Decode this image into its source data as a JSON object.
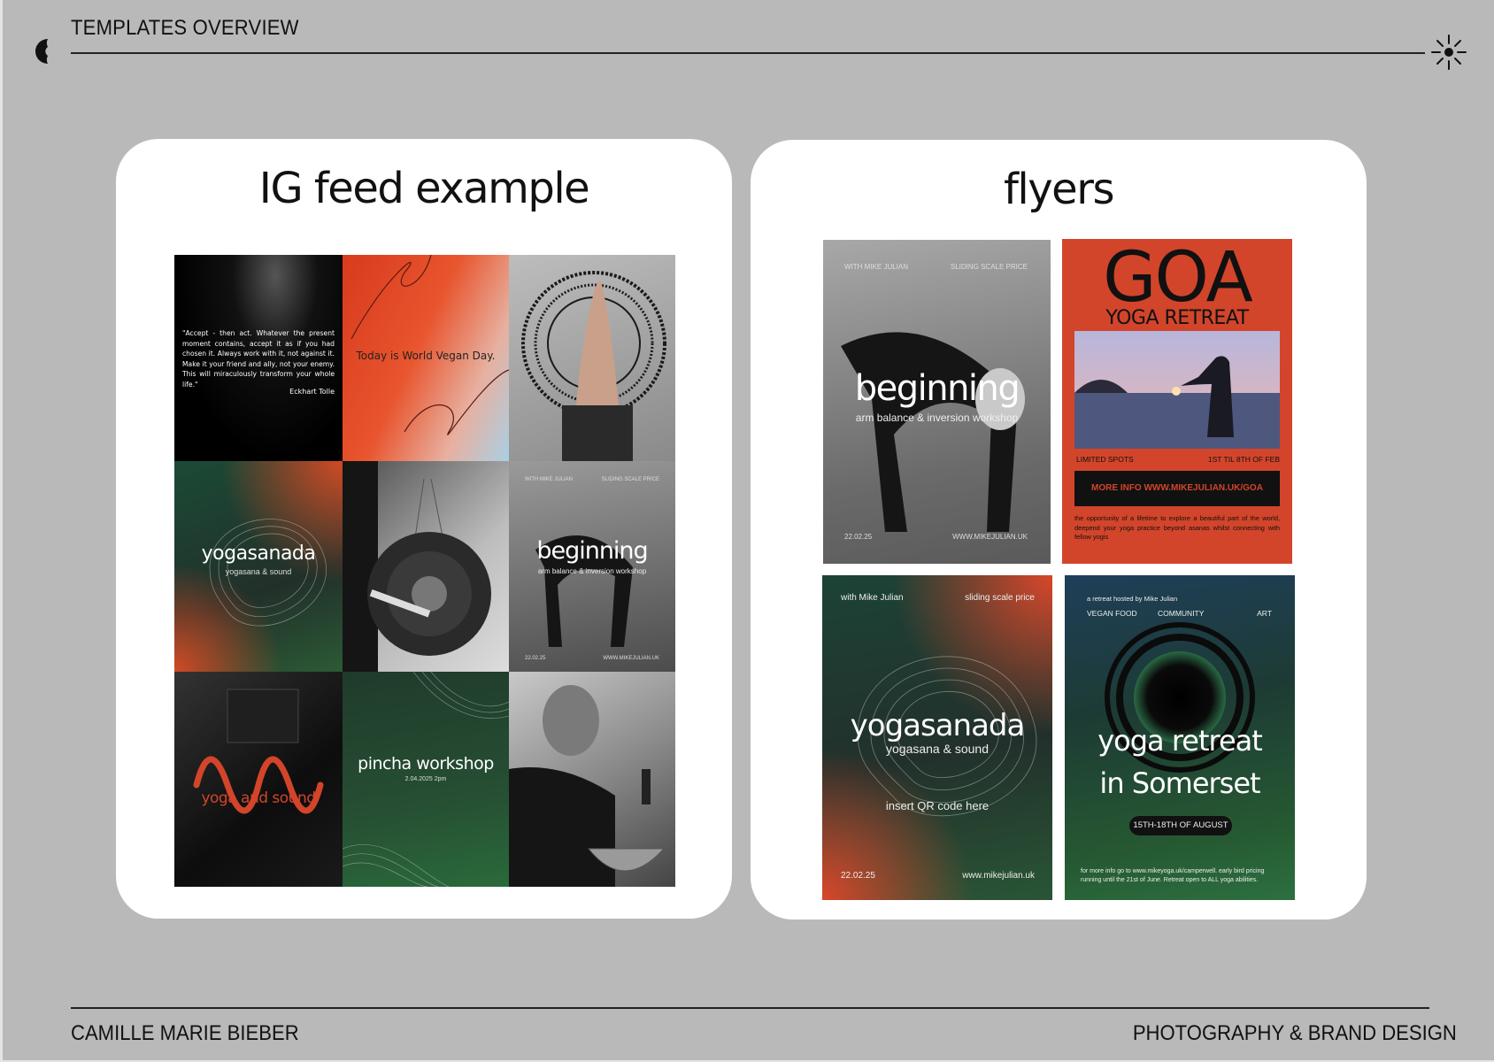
{
  "header": {
    "title": "TEMPLATES OVERVIEW",
    "logo_icon": "crescent-moon-icon",
    "corner_icon": "sun-icon"
  },
  "footer": {
    "left": "CAMILLE MARIE BIEBER",
    "right": "PHOTOGRAPHY & BRAND DESIGN"
  },
  "ig": {
    "title": "IG feed example",
    "quote": "\"Accept - then act. Whatever the present moment contains, accept it as if you had chosen it. Always work with it, not against it. Make it your friend and ally, not your enemy. This will miraculously transform your whole life.\"",
    "quote_author": "Eckhart Tolle",
    "vegan": "Today is World Vegan Day.",
    "yogasanada": "yogasanada",
    "yogasanada_sub": "yogasana & sound",
    "beginning_top_left": "WITH MIKE JULIAN",
    "beginning_top_right": "SLIDING SCALE PRICE",
    "beginning": "beginning",
    "beginning_sub": "arm balance & inversion workshop",
    "beginning_date": "22.02.25",
    "beginning_url": "WWW.MIKEJULIAN.UK",
    "yoga_sound": "yoga and sound",
    "pincha": "pincha workshop",
    "pincha_date": "2.04.2025 2pm"
  },
  "flyers": {
    "title": "flyers",
    "f1": {
      "top_left": "WITH MIKE JULIAN",
      "top_right": "SLIDING SCALE PRICE",
      "title": "beginning",
      "sub": "arm balance & inversion workshop",
      "date": "22.02.25",
      "url": "WWW.MIKEJULIAN.UK"
    },
    "f2": {
      "title": "GOA",
      "sub": "YOGA RETREAT",
      "left": "LIMITED SPOTS",
      "right": "1ST TIL 8TH OF FEB",
      "cta": "MORE INFO WWW.MIKEJULIAN.UK/GOA",
      "body": "the opportunity of a lifetime to explore a beautiful part of the world, deepend your yoga practice beyond asanas whilst connecting with fellow yogis"
    },
    "f3": {
      "top_left": "with Mike Julian",
      "top_right": "sliding scale price",
      "title": "yogasanada",
      "sub": "yogasana & sound",
      "qr": "insert QR code here",
      "date": "22.02.25",
      "url": "www.mikejulian.uk"
    },
    "f4": {
      "hosted": "a retreat hosted by Mike Julian",
      "tag1": "VEGAN FOOD",
      "tag2": "COMMUNITY",
      "tag3": "ART",
      "title1": "yoga retreat",
      "title2": "in Somerset",
      "dates": "15TH-18TH OF AUGUST",
      "body": "for more info go to www.mikeyoga.uk/camperwell. early bird pricing running until the 21st of June. Retreat open to ALL yoga abilities."
    }
  },
  "colors": {
    "background": "#b9b9b9",
    "accent_red": "#d2452a",
    "deep_green": "#1f4a2c"
  }
}
